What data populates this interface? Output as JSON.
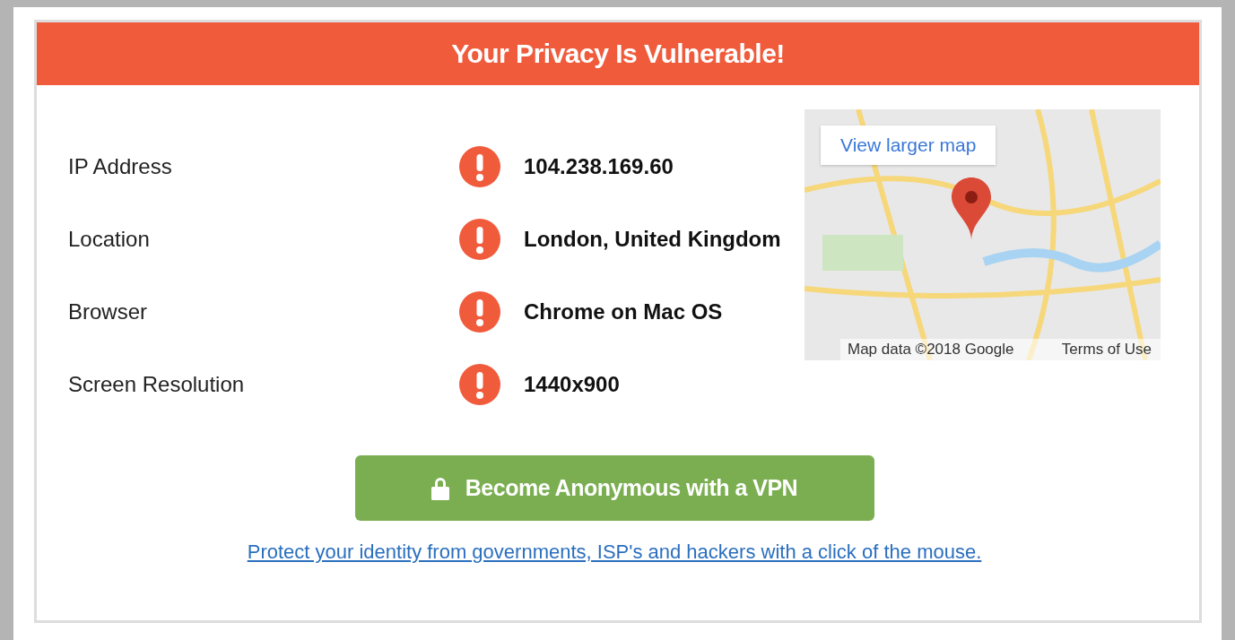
{
  "header": {
    "title": "Your Privacy Is Vulnerable!"
  },
  "details": [
    {
      "label": "IP Address",
      "value": "104.238.169.60"
    },
    {
      "label": "Location",
      "value": "London, United Kingdom"
    },
    {
      "label": "Browser",
      "value": "Chrome on Mac OS"
    },
    {
      "label": "Screen Resolution",
      "value": "1440x900"
    }
  ],
  "map": {
    "button": "View larger map",
    "attribution": "Map data ©2018 Google",
    "terms": "Terms of Use"
  },
  "cta_button": "Become Anonymous with a VPN",
  "link": "Protect your identity from governments, ISP's and hackers with a click of the mouse."
}
